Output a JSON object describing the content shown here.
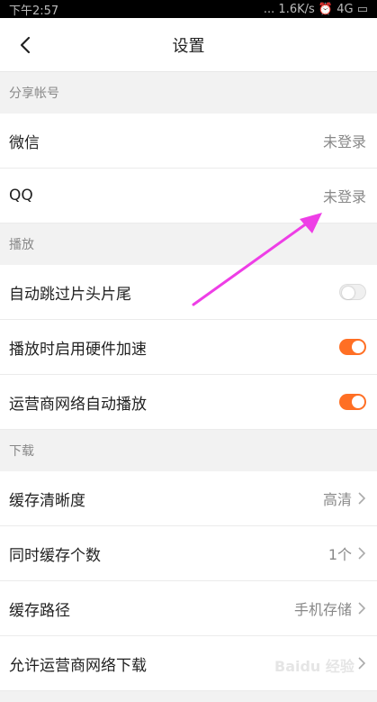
{
  "statusbar": {
    "time": "下午2:57",
    "right": "... 1.6K/s  ⏰  4G  ▭"
  },
  "header": {
    "title": "设置"
  },
  "sections": {
    "share": {
      "title": "分享帐号",
      "items": [
        {
          "label": "微信",
          "value": "未登录"
        },
        {
          "label": "QQ",
          "value": "未登录"
        }
      ]
    },
    "play": {
      "title": "播放",
      "items": [
        {
          "label": "自动跳过片头片尾",
          "state": "off"
        },
        {
          "label": "播放时启用硬件加速",
          "state": "on"
        },
        {
          "label": "运营商网络自动播放",
          "state": "on"
        }
      ]
    },
    "download": {
      "title": "下载",
      "items": [
        {
          "label": "缓存清晰度",
          "value": "高清"
        },
        {
          "label": "同时缓存个数",
          "value": "1个"
        },
        {
          "label": "缓存路径",
          "value": "手机存储"
        },
        {
          "label": "允许运营商网络下载",
          "value": ""
        }
      ]
    }
  },
  "watermark": {
    "text": "Baidu 经验"
  },
  "colors": {
    "accent": "#ff6f24",
    "annotation_arrow": "#ee3ee6"
  }
}
